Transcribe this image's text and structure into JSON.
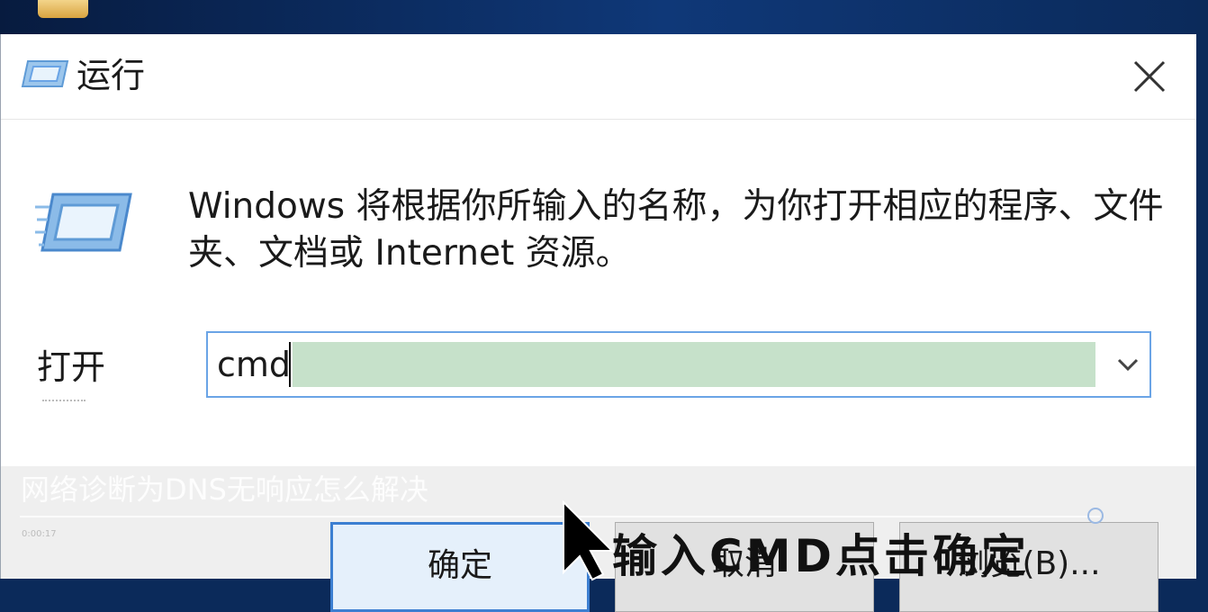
{
  "dialog": {
    "title": "运行",
    "description": "Windows 将根据你所输入的名称，为你打开相应的程序、文件夹、文档或 Internet 资源。",
    "open_label": "打开",
    "input_value": "cmd",
    "buttons": {
      "ok": "确定",
      "cancel": "取消",
      "browse": "浏览(B)..."
    }
  },
  "overlay": {
    "watermark": "网络诊断为DNS无响应怎么解决",
    "time": "0:00:17",
    "subtitle": "输入CMD点击确定"
  },
  "icons": {
    "title": "run-icon",
    "close": "close-icon",
    "dropdown": "chevron-down-icon",
    "cursor": "mouse-pointer-icon"
  },
  "colors": {
    "input_border": "#6aa4e6",
    "selection": "#c6e1ca",
    "ok_border": "#3c7fd1",
    "desktop": "#0b2a5a"
  }
}
